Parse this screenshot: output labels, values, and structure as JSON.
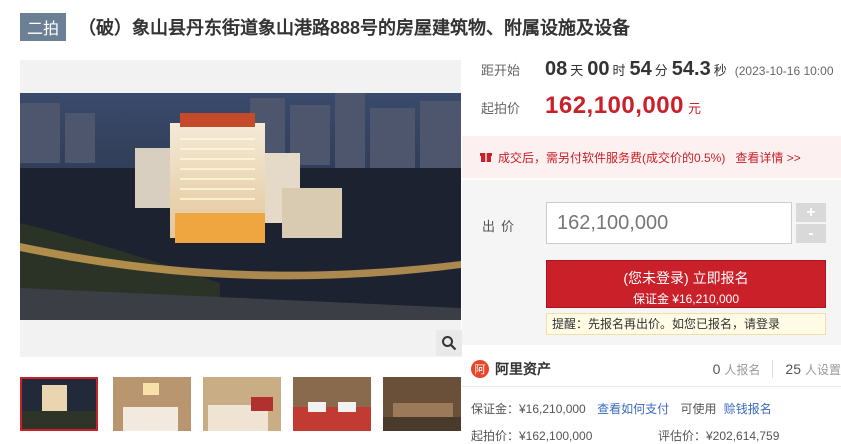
{
  "header": {
    "round_badge": "二拍",
    "title": "（破）象山县丹东街道象山港路888号的房屋建筑物、附属设施及设备"
  },
  "countdown": {
    "label": "距开始",
    "days": "08",
    "days_unit": "天",
    "hours": "00",
    "hours_unit": "时",
    "minutes": "54",
    "minutes_unit": "分",
    "seconds": "54.3",
    "seconds_unit": "秒",
    "start_time": "(2023-10-16 10:00"
  },
  "price": {
    "label": "起拍价",
    "value": "162,100,000",
    "unit": "元"
  },
  "notice": {
    "text": "成交后，需另付软件服务费(成交价的0.5%)",
    "link": "查看详情 >>"
  },
  "bid": {
    "label": "出价",
    "input_value": "162,100,000",
    "plus": "+",
    "minus": "-",
    "register_main": "(您未登录) 立即报名",
    "register_sub": "保证金 ¥16,210,000",
    "reminder_text": "提醒：先报名再出价。如您已报名，请",
    "reminder_link": "登录"
  },
  "platform": {
    "name": "阿里资产",
    "logo_glyph": "阿",
    "signups_count": "0",
    "signups_unit": "人报名",
    "reminders_count": "25",
    "reminders_unit": "人设置"
  },
  "info": {
    "deposit_label": "保证金：¥16,210,000",
    "deposit_link": "查看如何支付",
    "loan_prefix": "可使用",
    "loan_link": "赊钱报名",
    "start_price_label": "起拍价：¥162,100,000",
    "valuation_label": "评估价：¥202,614,759"
  },
  "icons": {
    "zoom": "magnifier-icon",
    "notice": "gift-icon"
  },
  "colors": {
    "accent": "#c9202a",
    "link": "#3a6bbd",
    "badge": "#6b7f95"
  }
}
